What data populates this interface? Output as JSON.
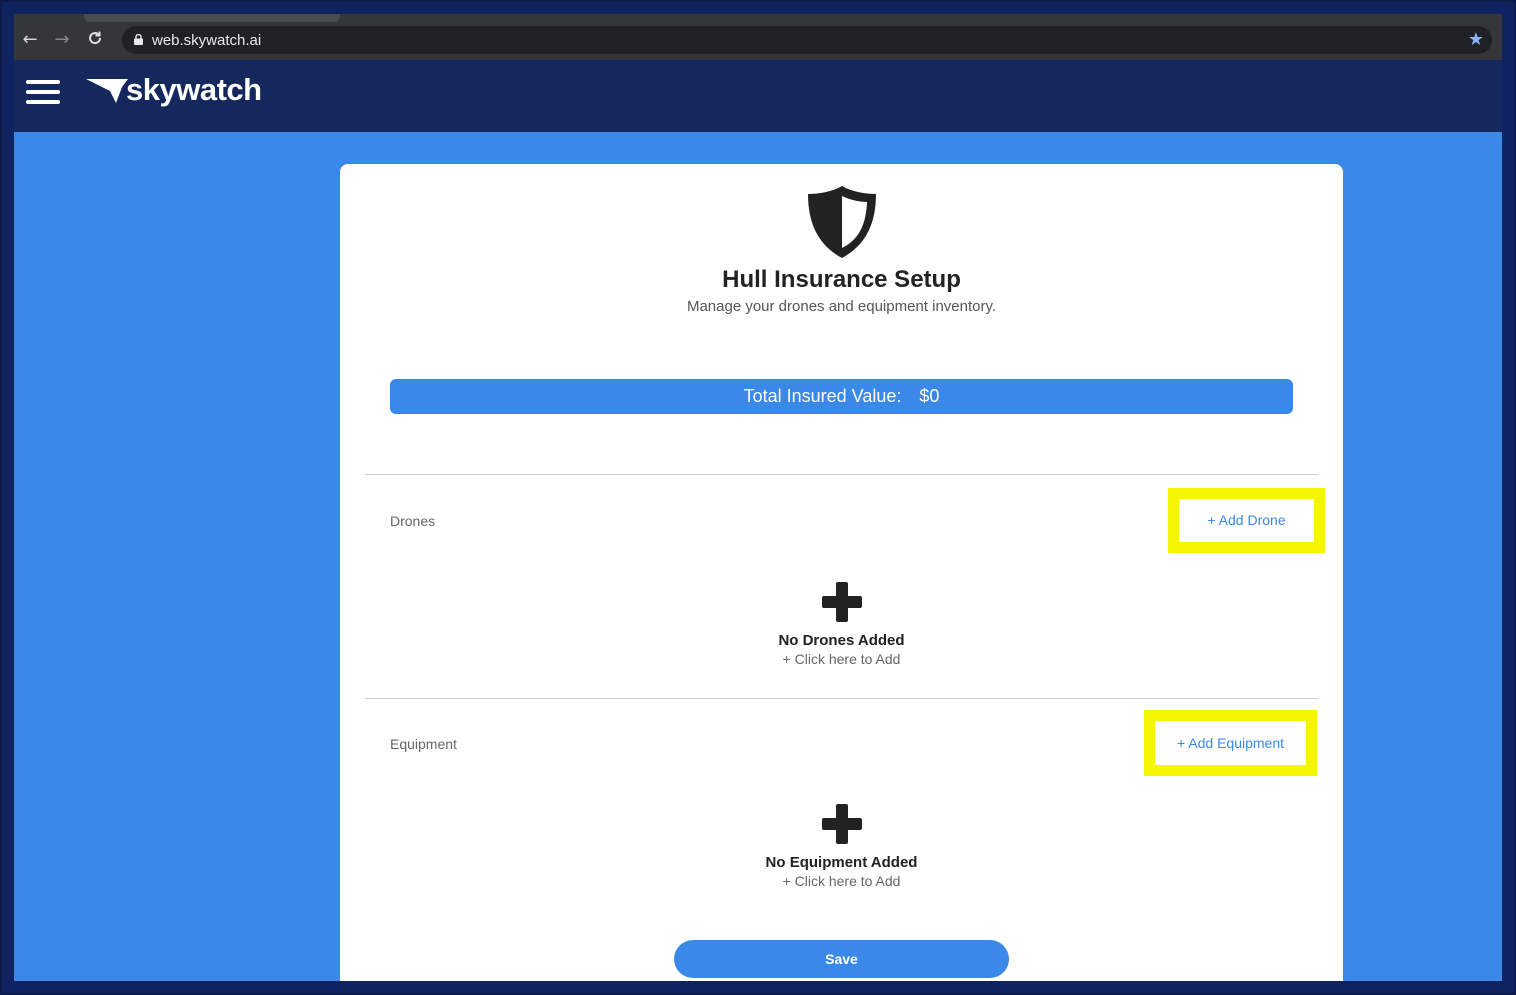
{
  "browser": {
    "url": "web.skywatch.ai"
  },
  "header": {
    "logo_text": "skywatch"
  },
  "card": {
    "title": "Hull Insurance Setup",
    "subtitle": "Manage your drones and equipment inventory.",
    "total_insured_label": "Total Insured Value:",
    "total_insured_value": "$0",
    "drones": {
      "label": "Drones",
      "add_label": "+ Add Drone",
      "empty_title": "No Drones Added",
      "empty_sub": "+ Click here to Add"
    },
    "equipment": {
      "label": "Equipment",
      "add_label": "+ Add Equipment",
      "empty_title": "No Equipment Added",
      "empty_sub": "+ Click here to Add"
    },
    "save_label": "Save"
  },
  "colors": {
    "accent": "#3a88e8",
    "header_bg": "#14285d",
    "highlight": "#f5f500"
  },
  "icons": [
    "back-icon",
    "forward-icon",
    "reload-icon",
    "lock-icon",
    "star-icon",
    "hamburger-icon",
    "skywatch-logo-icon",
    "shield-icon",
    "plus-icon"
  ]
}
